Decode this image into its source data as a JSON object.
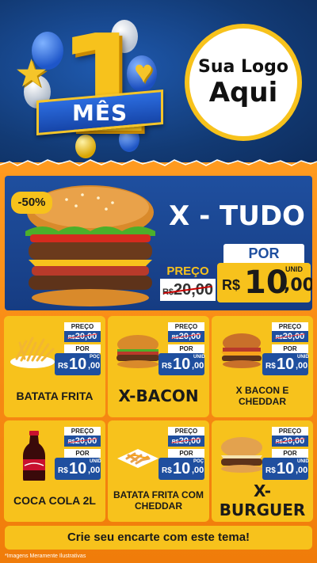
{
  "header": {
    "number": "1",
    "banner_label": "MÊS",
    "logo_line1": "Sua Logo",
    "logo_line2": "Aqui"
  },
  "hero": {
    "discount_badge": "-50%",
    "title": "X - TUDO",
    "preco_label": "PREÇO",
    "old_currency": "R$",
    "old_price": "20,00",
    "por_label": "POR",
    "currency": "R$",
    "price_int": "10",
    "price_dec": ",00",
    "unit": "UNID"
  },
  "products": [
    {
      "name": "BATATA FRITA",
      "icon": "fries-icon",
      "preco_label": "PREÇO",
      "old_currency": "R$",
      "old_price": "20,00",
      "por_label": "POR",
      "currency": "R$",
      "price_int": "10",
      "price_dec": ",00",
      "unit": "POÇ"
    },
    {
      "name": "X-BACON",
      "icon": "bacon-burger-icon",
      "preco_label": "PREÇO",
      "old_currency": "R$",
      "old_price": "20,00",
      "por_label": "POR",
      "currency": "R$",
      "price_int": "10",
      "price_dec": ",00",
      "unit": "UNID"
    },
    {
      "name": "X BACON E CHEDDAR",
      "icon": "cheddar-burger-icon",
      "preco_label": "PREÇO",
      "old_currency": "R$",
      "old_price": "20,00",
      "por_label": "POR",
      "currency": "R$",
      "price_int": "10",
      "price_dec": ",00",
      "unit": "UNID"
    },
    {
      "name": "COCA COLA 2L",
      "icon": "soda-bottle-icon",
      "preco_label": "PREÇO",
      "old_currency": "R$",
      "old_price": "20,00",
      "por_label": "POR",
      "currency": "R$",
      "price_int": "10",
      "price_dec": ",00",
      "unit": "UNID"
    },
    {
      "name": "BATATA FRITA COM CHEDDAR",
      "icon": "cheddar-fries-icon",
      "preco_label": "PREÇO",
      "old_currency": "R$",
      "old_price": "20,00",
      "por_label": "POR",
      "currency": "R$",
      "price_int": "10",
      "price_dec": ",00",
      "unit": "POÇ"
    },
    {
      "name": "X-BURGUER",
      "icon": "cheeseburger-icon",
      "preco_label": "PREÇO",
      "old_currency": "R$",
      "old_price": "20,00",
      "por_label": "POR",
      "currency": "R$",
      "price_int": "10",
      "price_dec": ",00",
      "unit": "UNID"
    }
  ],
  "footer": {
    "cta": "Crie seu encarte com este tema!",
    "disclaimer": "*Imagens Meramente Ilustrativas"
  },
  "colors": {
    "navy": "#123a74",
    "blue": "#1f4f9f",
    "yellow": "#f7c21c",
    "orange": "#f07c0a"
  }
}
